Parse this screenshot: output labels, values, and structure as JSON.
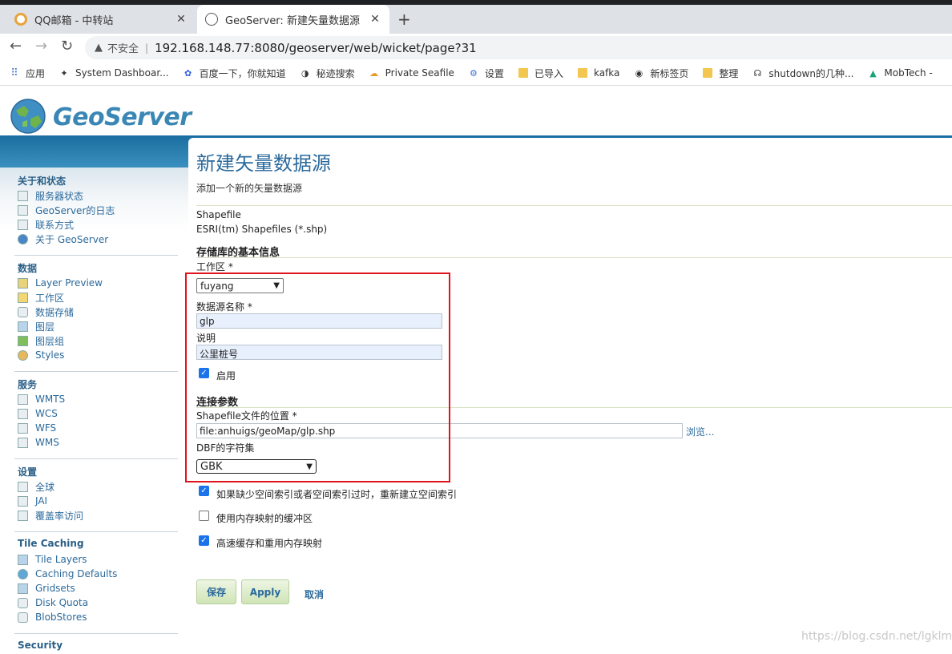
{
  "browser": {
    "tabs": [
      {
        "title": "QQ邮箱 - 中转站",
        "active": false
      },
      {
        "title": "GeoServer: 新建矢量数据源",
        "active": true
      }
    ],
    "address": {
      "security_label": "不安全",
      "url": "192.168.148.77:8080/geoserver/web/wicket/page?31"
    },
    "bookmarks": [
      {
        "label": "应用",
        "icon": "apps-grid-icon"
      },
      {
        "label": "System Dashboar...",
        "icon": "system-icon"
      },
      {
        "label": "百度一下，你就知道",
        "icon": "baidu-paw-icon"
      },
      {
        "label": "秘迹搜索",
        "icon": "mijisearch-icon"
      },
      {
        "label": "Private Seafile",
        "icon": "seafile-icon"
      },
      {
        "label": "设置",
        "icon": "gear-icon"
      },
      {
        "label": "已导入",
        "icon": "folder-icon"
      },
      {
        "label": "kafka",
        "icon": "folder-icon"
      },
      {
        "label": "新标签页",
        "icon": "globe-icon"
      },
      {
        "label": "整理",
        "icon": "folder-icon"
      },
      {
        "label": "shutdown的几种...",
        "icon": "shutdown-icon"
      },
      {
        "label": "MobTech -",
        "icon": "mobtech-icon"
      }
    ]
  },
  "header": {
    "logo_text": "GeoServer"
  },
  "sidebar": {
    "sections": [
      {
        "title": "关于和状态",
        "items": [
          "服务器状态",
          "GeoServer的日志",
          "联系方式",
          "关于 GeoServer"
        ]
      },
      {
        "title": "数据",
        "items": [
          "Layer Preview",
          "工作区",
          "数据存储",
          "图层",
          "图层组",
          "Styles"
        ]
      },
      {
        "title": "服务",
        "items": [
          "WMTS",
          "WCS",
          "WFS",
          "WMS"
        ]
      },
      {
        "title": "设置",
        "items": [
          "全球",
          "JAI",
          "覆盖率访问"
        ]
      },
      {
        "title": "Tile Caching",
        "items": [
          "Tile Layers",
          "Caching Defaults",
          "Gridsets",
          "Disk Quota",
          "BlobStores"
        ]
      },
      {
        "title": "Security",
        "items": []
      }
    ]
  },
  "main": {
    "title": "新建矢量数据源",
    "description": "添加一个新的矢量数据源",
    "store_type": "Shapefile",
    "store_type_desc": "ESRI(tm) Shapefiles (*.shp)",
    "basic_info_heading": "存储库的基本信息",
    "workspace_label": "工作区 *",
    "workspace_value": "fuyang",
    "name_label": "数据源名称 *",
    "name_value": "glp",
    "desc_label": "说明",
    "desc_value": "公里桩号",
    "enabled_label": "启用",
    "connection_heading": "连接参数",
    "shapefile_label": "Shapefile文件的位置 *",
    "shapefile_value": "file:anhuigs/geoMap/glp.shp",
    "browse_label": "浏览...",
    "charset_label": "DBF的字符集",
    "charset_value": "GBK",
    "options": [
      {
        "label": "如果缺少空间索引或者空间索引过时，重新建立空间索引",
        "checked": true
      },
      {
        "label": "使用内存映射的缓冲区",
        "checked": false
      },
      {
        "label": "高速缓存和重用内存映射",
        "checked": true
      }
    ],
    "save_label": "保存",
    "apply_label": "Apply",
    "cancel_label": "取消"
  },
  "watermark": "https://blog.csdn.net/lgklm"
}
